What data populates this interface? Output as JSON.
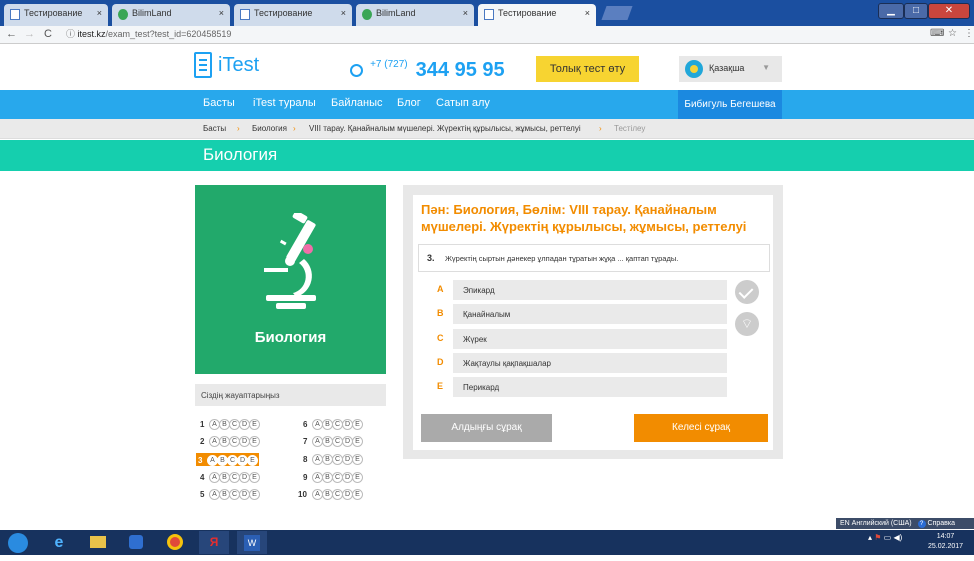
{
  "browser": {
    "tabs": [
      {
        "title": "Тестирование",
        "icon": "page-icon",
        "active": false
      },
      {
        "title": "BilimLand",
        "icon": "bilimland-icon",
        "active": false
      },
      {
        "title": "Тестирование",
        "icon": "page-icon",
        "active": false
      },
      {
        "title": "BilimLand",
        "icon": "bilimland-icon",
        "active": false
      },
      {
        "title": "Тестирование",
        "icon": "page-icon",
        "active": true
      }
    ],
    "close_glyph": "×",
    "url_host": "itest.kz",
    "url_path": "/exam_test?test_id=620458519"
  },
  "header": {
    "logo_text": "iTest",
    "phone_prefix": "+7 (727)",
    "phone_number": "344 95 95",
    "test_button": "Толық тест өту",
    "language": "Қазақша"
  },
  "nav": {
    "items": [
      "Басты",
      "iTest туралы",
      "Байланыс",
      "Блог",
      "Сатып алу"
    ],
    "user": "Бибигуль Бегешева"
  },
  "breadcrumb": {
    "items": [
      "Басты",
      "Биология",
      "VIII тарау. Қанайналым мүшелері. Жүректің құрылысы, жұмысы, реттелуі"
    ],
    "current": "Тестілеу",
    "separator": "›"
  },
  "page_title": "Биология",
  "subject_card": {
    "label": "Биология"
  },
  "answers": {
    "title": "Сіздің жауаптарыңыз",
    "letters": [
      "A",
      "B",
      "C",
      "D",
      "E"
    ],
    "rows": [
      "1",
      "2",
      "3",
      "4",
      "5",
      "6",
      "7",
      "8",
      "9",
      "10"
    ],
    "current_row": "3"
  },
  "question": {
    "heading": "Пән: Биология, Бөлім: VIII тарау. Қанайналым мүшелері. Жүректің құрылысы, жұмысы, реттелуі",
    "number": "3.",
    "text": "Жүректің сыртын дәнекер ұлпадан тұратын жұқа ... қаптап тұрады.",
    "options": [
      {
        "letter": "A",
        "text": "Эпикард"
      },
      {
        "letter": "B",
        "text": "Қанайналым"
      },
      {
        "letter": "C",
        "text": "Жүрек"
      },
      {
        "letter": "D",
        "text": "Жақтаулы қақпақшалар"
      },
      {
        "letter": "E",
        "text": "Перикард"
      }
    ],
    "prev_button": "Алдыңғы сұрақ",
    "next_button": "Келесі сұрақ"
  },
  "os": {
    "language_bar": "EN Английский (США)",
    "help": "Справка",
    "time": "14:07",
    "date": "25.02.2017"
  },
  "colors": {
    "accent_blue": "#28a8ec",
    "teal": "#15cfae",
    "green_card": "#22a96b",
    "orange": "#f28c00",
    "yellow": "#f7d431"
  }
}
